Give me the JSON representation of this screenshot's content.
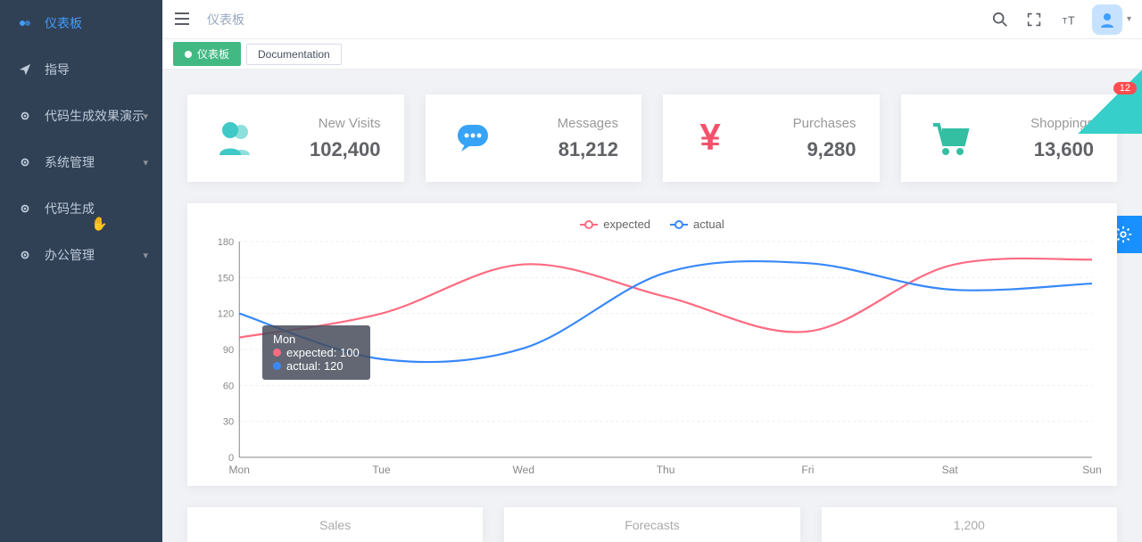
{
  "sidebar": {
    "items": [
      {
        "label": "仪表板",
        "icon": "dashboard",
        "active": true,
        "expandable": false
      },
      {
        "label": "指导",
        "icon": "paper-plane",
        "active": false,
        "expandable": false
      },
      {
        "label": "代码生成效果演示",
        "icon": "gear",
        "active": false,
        "expandable": true
      },
      {
        "label": "系统管理",
        "icon": "gear",
        "active": false,
        "expandable": true
      },
      {
        "label": "代码生成",
        "icon": "gear",
        "active": false,
        "expandable": false
      },
      {
        "label": "办公管理",
        "icon": "gear",
        "active": false,
        "expandable": true
      }
    ]
  },
  "breadcrumb": "仪表板",
  "tabs": [
    {
      "label": "仪表板",
      "active": true
    },
    {
      "label": "Documentation",
      "active": false
    }
  ],
  "corner_badge": "12",
  "stats": [
    {
      "label": "New Visits",
      "value": "102,400",
      "icon": "people",
      "color": "#40c9c6"
    },
    {
      "label": "Messages",
      "value": "81,212",
      "icon": "chat",
      "color": "#36a3f7"
    },
    {
      "label": "Purchases",
      "value": "9,280",
      "icon": "yen",
      "color": "#f4516c"
    },
    {
      "label": "Shoppings",
      "value": "13,600",
      "icon": "cart",
      "color": "#34bfa3"
    }
  ],
  "chart_data": {
    "type": "line",
    "title": "",
    "xlabel": "",
    "ylabel": "",
    "categories": [
      "Mon",
      "Tue",
      "Wed",
      "Thu",
      "Fri",
      "Sat",
      "Sun"
    ],
    "ylim": [
      0,
      180
    ],
    "yticks": [
      0,
      30,
      60,
      90,
      120,
      150,
      180
    ],
    "series": [
      {
        "name": "expected",
        "color": "#ff6b81",
        "values": [
          100,
          120,
          161,
          134,
          105,
          160,
          165
        ]
      },
      {
        "name": "actual",
        "color": "#3888fa",
        "values": [
          120,
          82,
          91,
          154,
          162,
          140,
          145
        ]
      }
    ],
    "tooltip": {
      "category": "Mon",
      "rows": [
        {
          "name": "expected",
          "value": 100,
          "color": "#ff6b81"
        },
        {
          "name": "actual",
          "value": 120,
          "color": "#3888fa"
        }
      ]
    }
  },
  "lower_panels": [
    {
      "title": "Sales"
    },
    {
      "title": "Forecasts"
    },
    {
      "title": "1,200"
    }
  ]
}
